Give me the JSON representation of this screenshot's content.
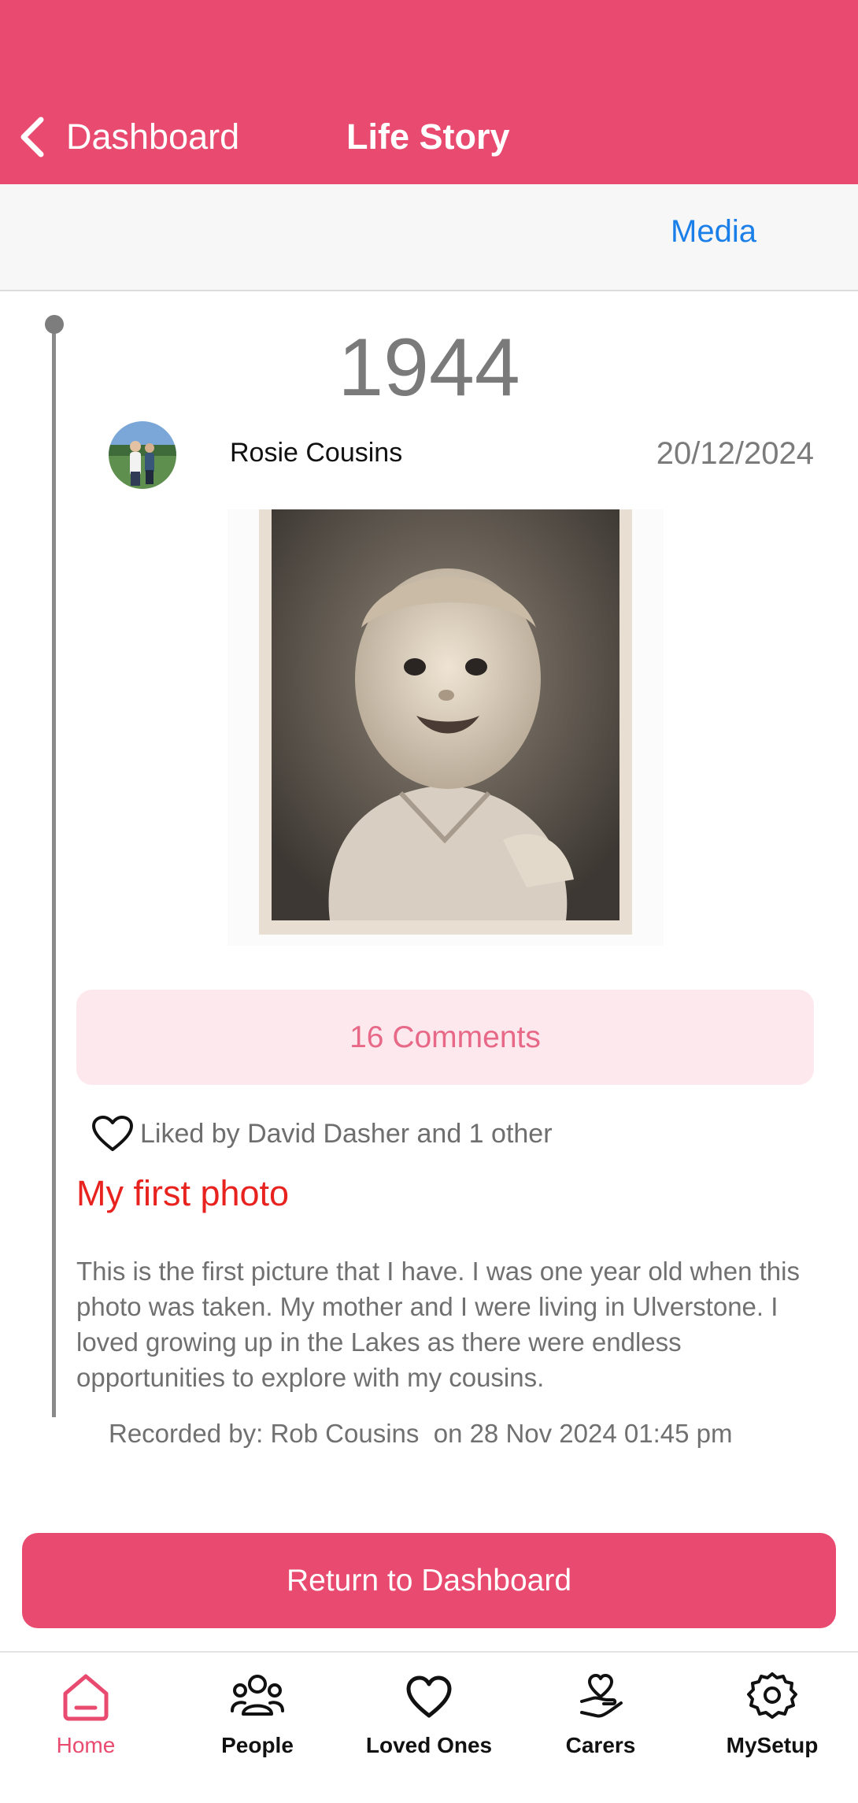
{
  "header": {
    "back_label": "Dashboard",
    "title": "Life Story",
    "color": "#e94b70"
  },
  "tabs": {
    "media_label": "Media"
  },
  "story": {
    "year": "1944",
    "author": "Rosie Cousins",
    "date": "20/12/2024",
    "comments_label": "16 Comments",
    "likes_text": "Liked by David Dasher and 1 other",
    "title": "My first photo",
    "body": "This is the first picture that I have. I was one year old when this photo was taken. My mother and I were living in Ulverstone. I loved growing up in the Lakes as there were endless opportunities to explore with my cousins.",
    "recorded_by": "Recorded by: Rob Cousins  on 28 Nov 2024 01:45 pm"
  },
  "return_button_label": "Return to Dashboard",
  "bottom_nav": {
    "items": [
      {
        "label": "Home",
        "icon": "home-icon",
        "active": true
      },
      {
        "label": "People",
        "icon": "people-icon",
        "active": false
      },
      {
        "label": "Loved Ones",
        "icon": "heart-icon",
        "active": false
      },
      {
        "label": "Carers",
        "icon": "carers-icon",
        "active": false
      },
      {
        "label": "MySetup",
        "icon": "gear-icon",
        "active": false
      }
    ]
  },
  "colors": {
    "accent": "#e94b70",
    "link": "#1a7fe8",
    "post_title": "#e8231f",
    "comments_bg": "#fde8ee"
  }
}
